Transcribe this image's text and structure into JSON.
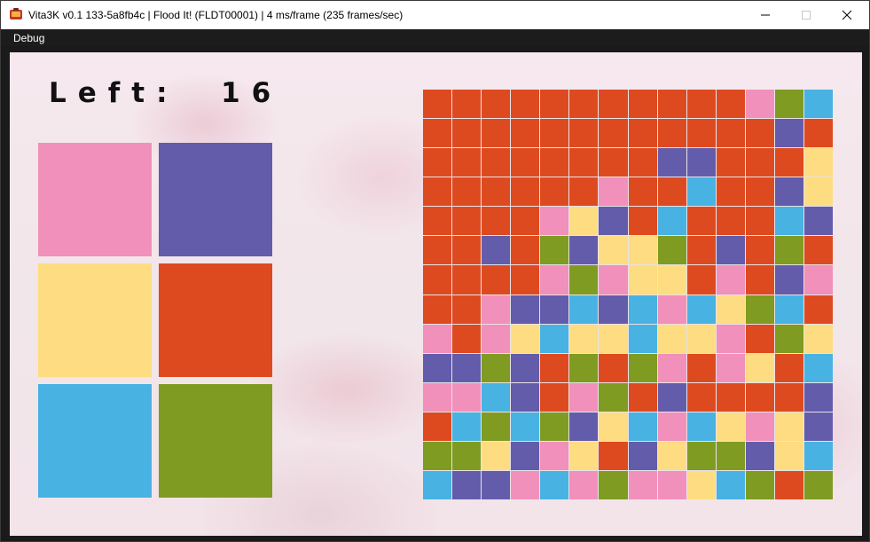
{
  "window": {
    "title": "Vita3K v0.1 133-5a8fb4c | Flood It! (FLDT00001) | 4 ms/frame (235 frames/sec)",
    "menu": [
      "Debug"
    ]
  },
  "game": {
    "moves_left_text": "Left:  16",
    "palette": {
      "P": "#f190ba",
      "V": "#635cab",
      "Y": "#fedc82",
      "R": "#de4a20",
      "B": "#48b2e3",
      "G": "#7f9b22"
    },
    "color_buttons": [
      {
        "name": "pink",
        "color": "P"
      },
      {
        "name": "purple",
        "color": "V"
      },
      {
        "name": "yellow",
        "color": "Y"
      },
      {
        "name": "red",
        "color": "R"
      },
      {
        "name": "blue",
        "color": "B"
      },
      {
        "name": "green",
        "color": "G"
      }
    ],
    "grid": [
      "RRRRRRRRRRRPGB",
      "RRRRRRRRRRRRVR",
      "RRRRRRRRVVRRRY",
      "RRRRRRPRRBRRVY",
      "RRRRPYVRBRRRBV",
      "RRVRGVYYGRVRGR",
      "RRRRPGPYYRPRVP",
      "RRPVVBVBPBYGBR",
      "PRPYBYYBYYPRGY",
      "VVGVRGRGPRPYRB",
      "PPBVRPGRVRRRRV",
      "RBGBGVYBPBYPYV",
      "GGYVPYRVYGGVYB",
      "BVVPBPGPPYBGRG"
    ]
  }
}
